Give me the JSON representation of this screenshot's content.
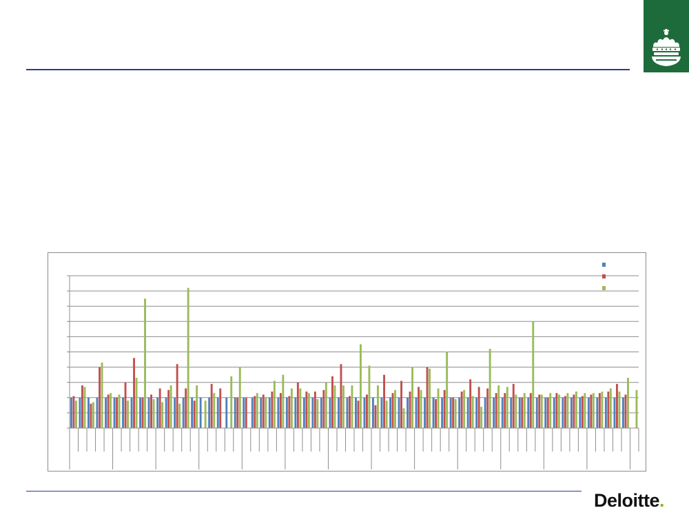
{
  "brand": {
    "logo_text": "Deloitte",
    "logo_dot": "."
  },
  "colors": {
    "rule": "#2b3a8f",
    "crest_bg": "#1d6b3a",
    "series_blue": "#4f81bd",
    "series_red": "#c0504d",
    "series_green": "#9bbb59",
    "gridline": "#8c8c8c",
    "logo_dot": "#86bc25"
  },
  "icons": {
    "crest": "crown-crest-icon"
  },
  "chart_data": {
    "type": "bar",
    "title": "",
    "xlabel": "",
    "ylabel": "",
    "ylim": [
      0,
      10
    ],
    "grid": true,
    "legend_position": "top-right",
    "series": [
      {
        "color": "#4f81bd",
        "values": [
          2,
          2,
          2,
          2,
          2,
          2,
          2,
          2,
          2,
          2,
          2,
          2,
          2,
          2,
          2,
          2,
          2,
          2,
          2,
          2,
          2,
          2,
          2,
          2,
          2,
          2,
          2,
          2,
          2,
          2,
          2,
          2,
          2,
          2,
          2,
          2,
          2,
          2,
          2,
          2,
          2,
          2,
          2,
          2,
          2,
          2,
          2,
          2,
          2,
          2,
          2,
          2,
          2,
          2,
          2,
          2,
          2,
          2,
          2,
          2,
          2,
          2,
          2,
          2,
          2
        ]
      },
      {
        "color": "#c0504d",
        "values": [
          2.1,
          2.8,
          1.6,
          4.0,
          2.2,
          2.0,
          3.0,
          4.6,
          2.0,
          2.2,
          2.6,
          2.5,
          4.2,
          2.6,
          1.8,
          0,
          2.9,
          2.6,
          0,
          2.0,
          2.0,
          2.1,
          2.2,
          2.4,
          2.3,
          2.1,
          3.0,
          2.4,
          2.4,
          2.5,
          3.4,
          4.2,
          2.1,
          1.8,
          2.2,
          1.5,
          3.5,
          2.3,
          3.1,
          2.4,
          2.7,
          4.0,
          1.9,
          2.5,
          2.0,
          2.4,
          3.2,
          2.7,
          2.6,
          2.3,
          2.3,
          2.9,
          2.0,
          2.3,
          2.2,
          2.0,
          2.3,
          2.1,
          2.2,
          2.1,
          2.2,
          2.3,
          2.4,
          2.9,
          2.2
        ]
      },
      {
        "color": "#9bbb59",
        "values": [
          1.8,
          2.7,
          1.7,
          4.3,
          2.3,
          2.2,
          1.8,
          3.3,
          8.5,
          1.9,
          1.7,
          2.8,
          1.6,
          9.2,
          2.8,
          1.8,
          2.3,
          0,
          3.4,
          4.0,
          0,
          2.3,
          2.0,
          3.1,
          3.5,
          2.6,
          2.6,
          2.3,
          1.9,
          3.0,
          2.8,
          2.8,
          2.8,
          5.5,
          4.1,
          2.8,
          1.8,
          2.5,
          1.3,
          4.0,
          2.5,
          3.9,
          2.6,
          5.0,
          1.9,
          2.5,
          2.1,
          1.4,
          5.2,
          2.8,
          2.7,
          2.2,
          2.3,
          7.0,
          2.2,
          2.3,
          2.2,
          2.3,
          2.4,
          2.3,
          2.3,
          2.4,
          2.6,
          2.4,
          3.3,
          2.5
        ]
      }
    ]
  }
}
